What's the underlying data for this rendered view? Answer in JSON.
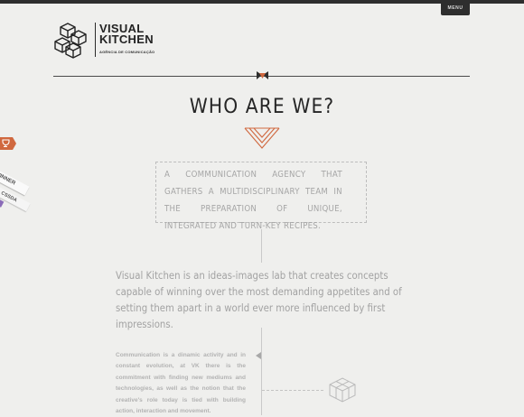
{
  "header": {
    "menu_label": "MENU",
    "logo": {
      "line1": "VISUAL",
      "line2": "KITCHEN",
      "tagline": "AGÊNCIA DE COMUNICAÇÃO",
      "icon": "isometric-cube-logo-icon"
    }
  },
  "main": {
    "title": "WHO ARE WE?",
    "intro": "A communication agency that gathers a multidisciplinary team in the preparation of unique, integrated and turn-key recipes.",
    "lead": "Visual Kitchen is an ideas-images lab that creates concepts capable of winning over the most demanding appetites and of setting them apart in a world ever more influenced by first impressions.",
    "body": "Communication is a dinamic activity and in constant evolution, at VK there is the commitment with finding new mediums and technologies, as well as the notion that the creative's role today is tied with building action, interaction and movement."
  },
  "side_badges": {
    "winner_label": "WINNER",
    "css_label": "CSSDA",
    "award_icon": "trophy-icon"
  },
  "colors": {
    "background": "#efefed",
    "dark": "#2e2e2e",
    "accent": "#d0683f",
    "muted_text": "#a6a6a6"
  }
}
